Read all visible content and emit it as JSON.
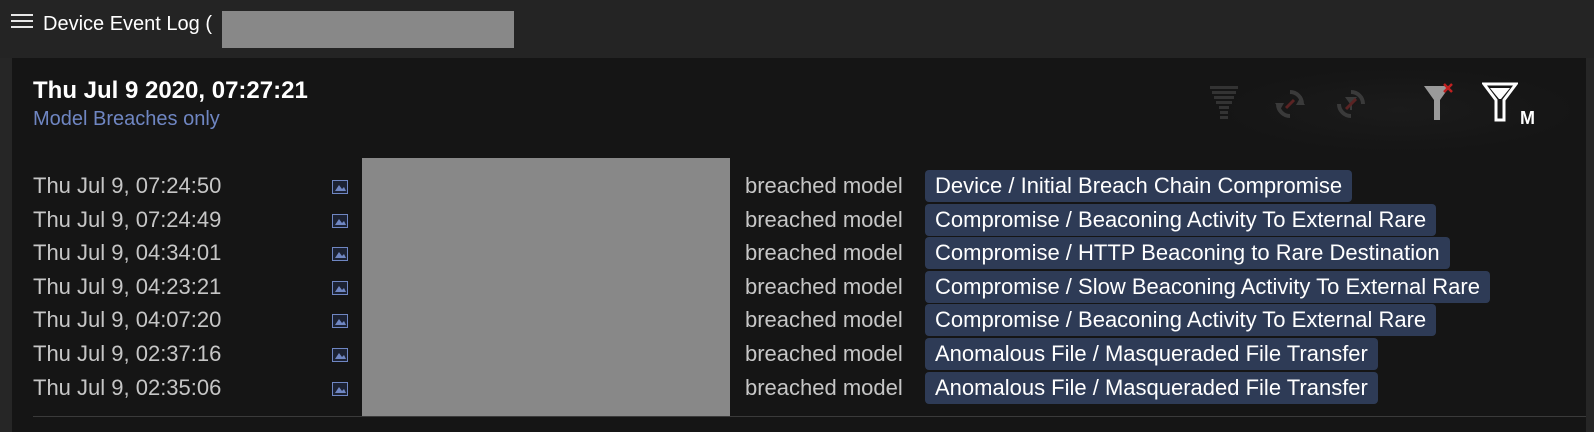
{
  "window": {
    "title": "Device Event Log ("
  },
  "header": {
    "timestamp": "Thu Jul 9 2020, 07:27:21",
    "filter_label": "Model Breaches only"
  },
  "toolbar": {
    "icons": [
      "stack-filter-icon",
      "refresh-icon",
      "refresh-filter-icon",
      "filter-clear-icon",
      "filter-models-icon"
    ],
    "filter_models_badge": "M"
  },
  "events": [
    {
      "time": "Thu Jul 9, 07:24:50",
      "action": "breached model",
      "model": "Device / Initial Breach Chain Compromise"
    },
    {
      "time": "Thu Jul 9, 07:24:49",
      "action": "breached model",
      "model": "Compromise / Beaconing Activity To External Rare"
    },
    {
      "time": "Thu Jul 9, 04:34:01",
      "action": "breached model",
      "model": "Compromise / HTTP Beaconing to Rare Destination"
    },
    {
      "time": "Thu Jul 9, 04:23:21",
      "action": "breached model",
      "model": "Compromise / Slow Beaconing Activity To External Rare"
    },
    {
      "time": "Thu Jul 9, 04:07:20",
      "action": "breached model",
      "model": "Compromise / Beaconing Activity To External Rare"
    },
    {
      "time": "Thu Jul 9, 02:37:16",
      "action": "breached model",
      "model": "Anomalous File / Masqueraded File Transfer"
    },
    {
      "time": "Thu Jul 9, 02:35:06",
      "action": "breached model",
      "model": "Anomalous File / Masqueraded File Transfer"
    }
  ],
  "colors": {
    "background": "#151515",
    "titlebar": "#242424",
    "accent_text": "#6f86c2",
    "model_pill": "#2e3b56",
    "redaction": "#888888"
  }
}
